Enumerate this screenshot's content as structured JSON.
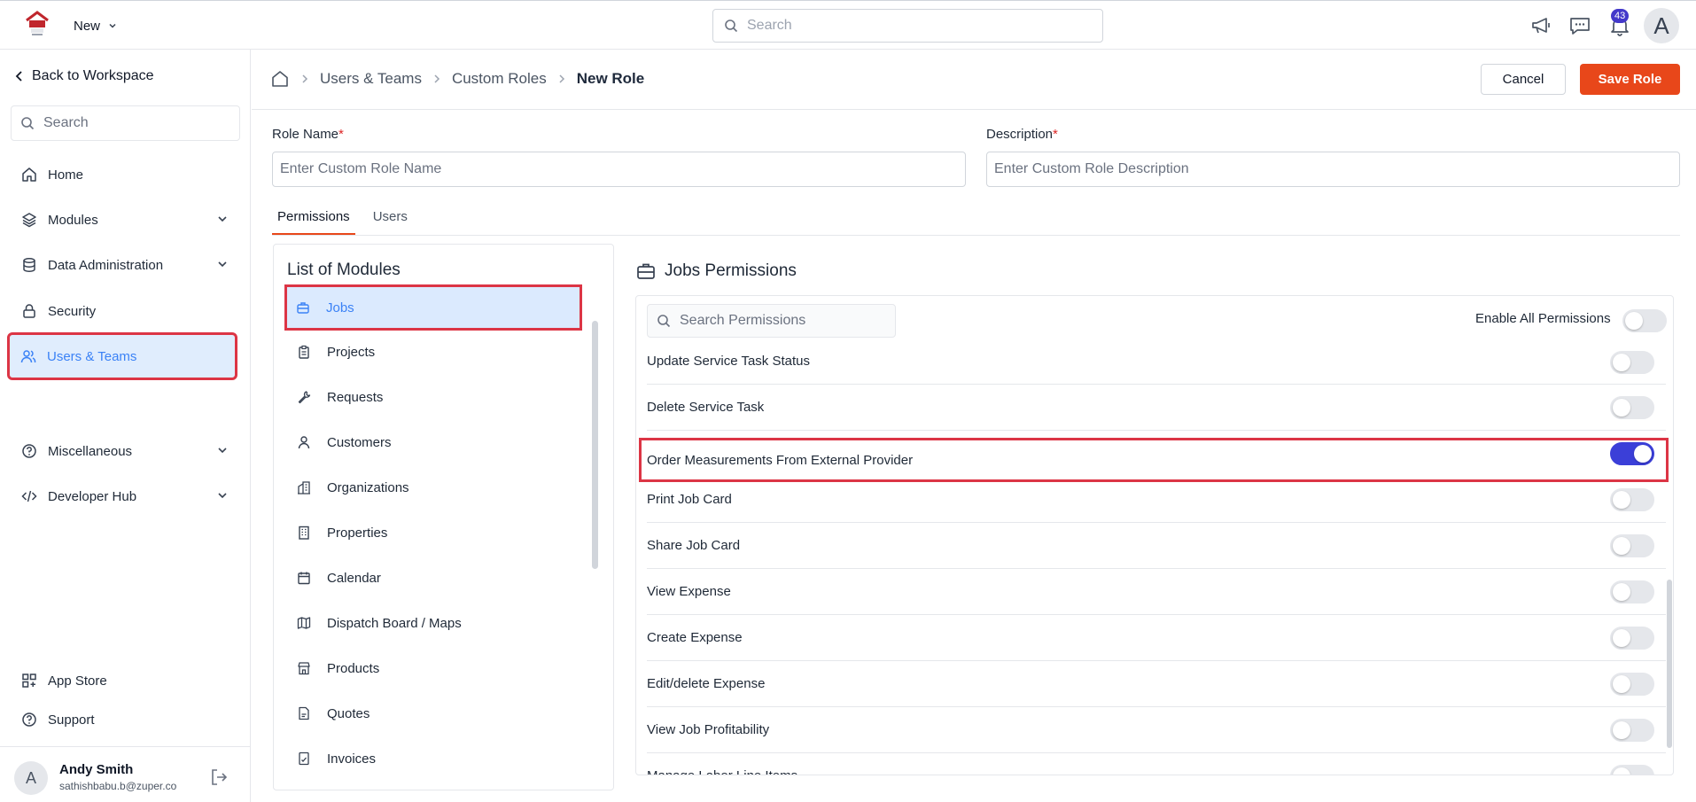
{
  "topbar": {
    "new_label": "New",
    "search_placeholder": "Search",
    "notification_count": "43",
    "avatar_letter": "A"
  },
  "sidebar": {
    "back_label": "Back to Workspace",
    "search_placeholder": "Search",
    "items": [
      {
        "label": "Home",
        "icon": "home-icon"
      },
      {
        "label": "Modules",
        "icon": "layers-icon"
      },
      {
        "label": "Data Administration",
        "icon": "database-icon"
      },
      {
        "label": "Security",
        "icon": "lock-icon"
      },
      {
        "label": "Users & Teams",
        "icon": "users-icon"
      },
      {
        "label": "Miscellaneous",
        "icon": "help-circle-icon"
      },
      {
        "label": "Developer Hub",
        "icon": "code-icon"
      }
    ],
    "bottom_items": [
      {
        "label": "App Store",
        "icon": "grid-plus-icon"
      },
      {
        "label": "Support",
        "icon": "help-circle-icon"
      }
    ],
    "user": {
      "initial": "A",
      "name": "Andy Smith",
      "email": "sathishbabu.b@zuper.co"
    }
  },
  "breadcrumb": {
    "items": [
      "Users & Teams",
      "Custom Roles"
    ],
    "current": "New Role"
  },
  "actions": {
    "cancel_label": "Cancel",
    "save_label": "Save Role"
  },
  "form": {
    "role_name_label": "Role Name",
    "role_name_placeholder": "Enter Custom Role Name",
    "description_label": "Description",
    "description_placeholder": "Enter Custom Role Description",
    "required_mark": "*"
  },
  "tabs": [
    {
      "label": "Permissions"
    },
    {
      "label": "Users"
    }
  ],
  "modules": {
    "title": "List of Modules",
    "items": [
      {
        "label": "Jobs",
        "icon": "briefcase-icon"
      },
      {
        "label": "Projects",
        "icon": "clipboard-icon"
      },
      {
        "label": "Requests",
        "icon": "wrench-icon"
      },
      {
        "label": "Customers",
        "icon": "user-icon"
      },
      {
        "label": "Organizations",
        "icon": "building-icon"
      },
      {
        "label": "Properties",
        "icon": "office-building-icon"
      },
      {
        "label": "Calendar",
        "icon": "calendar-icon"
      },
      {
        "label": "Dispatch Board / Maps",
        "icon": "map-icon"
      },
      {
        "label": "Products",
        "icon": "store-icon"
      },
      {
        "label": "Quotes",
        "icon": "document-icon"
      },
      {
        "label": "Invoices",
        "icon": "invoice-icon"
      }
    ]
  },
  "permissions": {
    "title": "Jobs Permissions",
    "search_placeholder": "Search Permissions",
    "enable_all_label": "Enable All Permissions",
    "enable_all": false,
    "items": [
      {
        "label": "Update Service Task Status",
        "enabled": false
      },
      {
        "label": "Delete Service Task",
        "enabled": false
      },
      {
        "label": "Order Measurements From External Provider",
        "enabled": true
      },
      {
        "label": "Print Job Card",
        "enabled": false
      },
      {
        "label": "Share Job Card",
        "enabled": false
      },
      {
        "label": "View Expense",
        "enabled": false
      },
      {
        "label": "Create Expense",
        "enabled": false
      },
      {
        "label": "Edit/delete Expense",
        "enabled": false
      },
      {
        "label": "View Job Profitability",
        "enabled": false
      },
      {
        "label": "Manage Labor Line Items",
        "enabled": false
      }
    ]
  },
  "colors": {
    "accent": "#e8471a",
    "active_blue": "#3b82f6",
    "toggle_on": "#3b3fd8",
    "highlight_outline": "#dc3545"
  }
}
